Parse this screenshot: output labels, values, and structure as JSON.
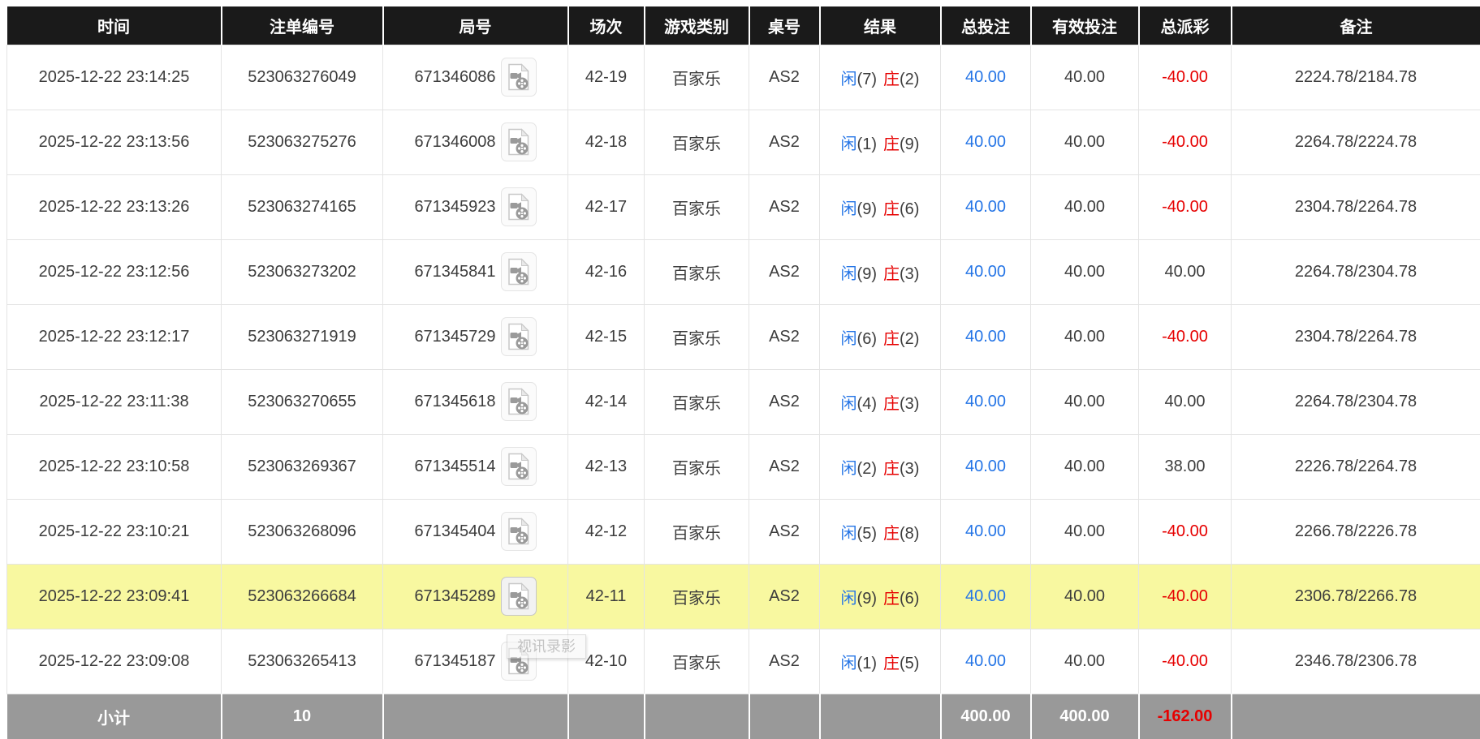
{
  "tooltip_text": "视讯录影",
  "colors": {
    "header_bg": "#1a1a1a",
    "header_text": "#ffffff",
    "highlight_row": "#f8f8a0",
    "player_blue": "#2575e6",
    "banker_red": "#e60000",
    "negative_red": "#e60000",
    "footer_bg": "#999999",
    "footer_text": "#ffffff"
  },
  "icons": {
    "video_replay": "film-document-icon"
  },
  "table": {
    "columns": [
      "时间",
      "注单编号",
      "局号",
      "场次",
      "游戏类别",
      "桌号",
      "结果",
      "总投注",
      "有效投注",
      "总派彩",
      "备注"
    ],
    "rows": [
      {
        "time": "2025-12-22 23:14:25",
        "bet_id": "523063276049",
        "round_id": "671346086",
        "session": "42-19",
        "game": "百家乐",
        "table_no": "AS2",
        "player_label": "闲",
        "player_value": "(7)",
        "banker_label": "庄",
        "banker_value": "(2)",
        "total_bet": "40.00",
        "valid_bet": "40.00",
        "payout": "-40.00",
        "remark": "2224.78/2184.78",
        "highlight": false,
        "show_tooltip": false
      },
      {
        "time": "2025-12-22 23:13:56",
        "bet_id": "523063275276",
        "round_id": "671346008",
        "session": "42-18",
        "game": "百家乐",
        "table_no": "AS2",
        "player_label": "闲",
        "player_value": "(1)",
        "banker_label": "庄",
        "banker_value": "(9)",
        "total_bet": "40.00",
        "valid_bet": "40.00",
        "payout": "-40.00",
        "remark": "2264.78/2224.78",
        "highlight": false,
        "show_tooltip": false
      },
      {
        "time": "2025-12-22 23:13:26",
        "bet_id": "523063274165",
        "round_id": "671345923",
        "session": "42-17",
        "game": "百家乐",
        "table_no": "AS2",
        "player_label": "闲",
        "player_value": "(9)",
        "banker_label": "庄",
        "banker_value": "(6)",
        "total_bet": "40.00",
        "valid_bet": "40.00",
        "payout": "-40.00",
        "remark": "2304.78/2264.78",
        "highlight": false,
        "show_tooltip": false
      },
      {
        "time": "2025-12-22 23:12:56",
        "bet_id": "523063273202",
        "round_id": "671345841",
        "session": "42-16",
        "game": "百家乐",
        "table_no": "AS2",
        "player_label": "闲",
        "player_value": "(9)",
        "banker_label": "庄",
        "banker_value": "(3)",
        "total_bet": "40.00",
        "valid_bet": "40.00",
        "payout": "40.00",
        "remark": "2264.78/2304.78",
        "highlight": false,
        "show_tooltip": false
      },
      {
        "time": "2025-12-22 23:12:17",
        "bet_id": "523063271919",
        "round_id": "671345729",
        "session": "42-15",
        "game": "百家乐",
        "table_no": "AS2",
        "player_label": "闲",
        "player_value": "(6)",
        "banker_label": "庄",
        "banker_value": "(2)",
        "total_bet": "40.00",
        "valid_bet": "40.00",
        "payout": "-40.00",
        "remark": "2304.78/2264.78",
        "highlight": false,
        "show_tooltip": false
      },
      {
        "time": "2025-12-22 23:11:38",
        "bet_id": "523063270655",
        "round_id": "671345618",
        "session": "42-14",
        "game": "百家乐",
        "table_no": "AS2",
        "player_label": "闲",
        "player_value": "(4)",
        "banker_label": "庄",
        "banker_value": "(3)",
        "total_bet": "40.00",
        "valid_bet": "40.00",
        "payout": "40.00",
        "remark": "2264.78/2304.78",
        "highlight": false,
        "show_tooltip": false
      },
      {
        "time": "2025-12-22 23:10:58",
        "bet_id": "523063269367",
        "round_id": "671345514",
        "session": "42-13",
        "game": "百家乐",
        "table_no": "AS2",
        "player_label": "闲",
        "player_value": "(2)",
        "banker_label": "庄",
        "banker_value": "(3)",
        "total_bet": "40.00",
        "valid_bet": "40.00",
        "payout": "38.00",
        "remark": "2226.78/2264.78",
        "highlight": false,
        "show_tooltip": false
      },
      {
        "time": "2025-12-22 23:10:21",
        "bet_id": "523063268096",
        "round_id": "671345404",
        "session": "42-12",
        "game": "百家乐",
        "table_no": "AS2",
        "player_label": "闲",
        "player_value": "(5)",
        "banker_label": "庄",
        "banker_value": "(8)",
        "total_bet": "40.00",
        "valid_bet": "40.00",
        "payout": "-40.00",
        "remark": "2266.78/2226.78",
        "highlight": false,
        "show_tooltip": false
      },
      {
        "time": "2025-12-22 23:09:41",
        "bet_id": "523063266684",
        "round_id": "671345289",
        "session": "42-11",
        "game": "百家乐",
        "table_no": "AS2",
        "player_label": "闲",
        "player_value": "(9)",
        "banker_label": "庄",
        "banker_value": "(6)",
        "total_bet": "40.00",
        "valid_bet": "40.00",
        "payout": "-40.00",
        "remark": "2306.78/2266.78",
        "highlight": true,
        "show_tooltip": false
      },
      {
        "time": "2025-12-22 23:09:08",
        "bet_id": "523063265413",
        "round_id": "671345187",
        "session": "42-10",
        "game": "百家乐",
        "table_no": "AS2",
        "player_label": "闲",
        "player_value": "(1)",
        "banker_label": "庄",
        "banker_value": "(5)",
        "total_bet": "40.00",
        "valid_bet": "40.00",
        "payout": "-40.00",
        "remark": "2346.78/2306.78",
        "highlight": false,
        "show_tooltip": true
      }
    ],
    "footer": {
      "label": "小计",
      "count": "10",
      "total_bet": "400.00",
      "valid_bet": "400.00",
      "payout": "-162.00"
    }
  }
}
